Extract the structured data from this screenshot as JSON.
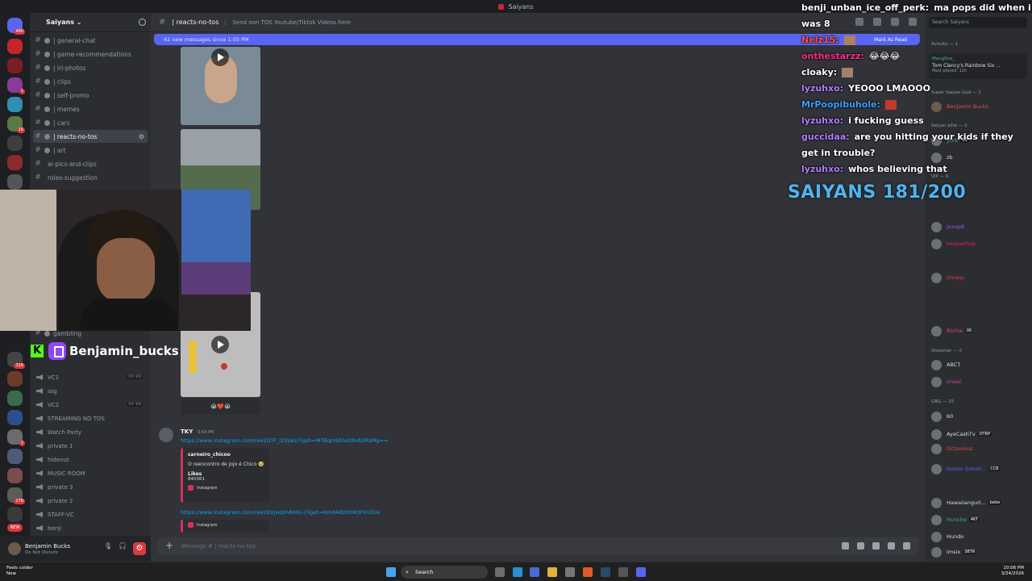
{
  "window": {
    "title": "Saiyans"
  },
  "server": {
    "name": "Saiyans ⌄"
  },
  "channels": [
    {
      "label": "| general-chat"
    },
    {
      "label": "| game-recommendations"
    },
    {
      "label": "| irl-photos"
    },
    {
      "label": "| clips"
    },
    {
      "label": "| self-promo"
    },
    {
      "label": "| memes"
    },
    {
      "label": "| cars"
    },
    {
      "label": "| reacts-no-tos"
    },
    {
      "label": "| art"
    },
    {
      "label": "ai-pics-and-clips"
    },
    {
      "label": "roles-suggestion"
    },
    {
      "label": "gambling"
    }
  ],
  "voice_channels": [
    {
      "label": "VC1",
      "count": "00 99"
    },
    {
      "label": "ssg"
    },
    {
      "label": "VC2",
      "count": "00 99"
    },
    {
      "label": "STREAMING NO TOS"
    },
    {
      "label": "Watch Party"
    },
    {
      "label": "private 1"
    },
    {
      "label": "hideout"
    },
    {
      "label": "MUSIC ROOM"
    },
    {
      "label": "private 3"
    },
    {
      "label": "private 2"
    },
    {
      "label": "STAFF-VC"
    },
    {
      "label": "benji"
    }
  ],
  "rail_badges": [
    "480",
    "1",
    "16",
    "316",
    "2",
    "278",
    "NEW"
  ],
  "user_panel": {
    "name": "Benjamin Bucks",
    "status": "Do Not Disturb"
  },
  "chat": {
    "channel": "| reacts-no-tos",
    "topic": "Send non TOS Youtube/Tiktok Videos here",
    "new_messages": "42 new messages since 1:05 PM",
    "mark_read": "Mark As Read",
    "media_reaction": "😭❤️😭",
    "message": {
      "author": "TKY",
      "time": "9:54 PM",
      "link1": "https://www.instagram.com/reel/DTF_l2Vjski/?igsh=MTBqcHZ0eDRxb2RsMg==",
      "embed": {
        "author": "carneiro_chicoo",
        "description": "O reencontro de jojo é Chico 🥹",
        "likes_label": "Likes",
        "likes": "840361",
        "footer": "Instagram"
      },
      "link2": "https://www.instagram.com/reel/DVJwQmRiHU-/?igsh=bmd4dDhhM3FkY2Ux",
      "footer2": "Instagram"
    },
    "composer_placeholder": "Message # | reacts-no-tos"
  },
  "members": {
    "search_placeholder": "Search Saiyans",
    "activity_header": "Activity — 1",
    "activity": {
      "user": "Mang0ne_",
      "game": "Tom Clancy's Rainbow Six ...",
      "note": "Most played: 11h"
    },
    "sections": [
      {
        "title": "Super Saiyan God — 1",
        "members": [
          {
            "name": "Benjamin Bucks",
            "tag": "",
            "color": "#f04747"
          }
        ]
      },
      {
        "title": "Saiyan elite — 2",
        "members": [
          {
            "name": "yurk",
            "tag": "99",
            "color": "#43b581"
          },
          {
            "name": "zb",
            "tag": "",
            "color": "#dbdee1"
          }
        ]
      },
      {
        "title": "VIP — 9",
        "members": [
          {
            "name": "jxxup9",
            "tag": "",
            "color": "#a259ff"
          },
          {
            "name": "beepachop",
            "tag": "",
            "color": "#e91e63"
          },
          {
            "name": "ohrags",
            "tag": "",
            "color": "#e04040"
          },
          {
            "name": "Richie",
            "tag": "00",
            "color": "#e0409b"
          }
        ]
      },
      {
        "title": "Streamer — 2",
        "members": [
          {
            "name": "ABCT",
            "tag": "",
            "color": "#dbdee1"
          },
          {
            "name": "oneal",
            "tag": "",
            "color": "#e0409b"
          }
        ]
      },
      {
        "title": "GBG — 25",
        "members": [
          {
            "name": "60",
            "tag": "",
            "color": "#dbdee1"
          },
          {
            "name": "AyeCashTv",
            "tag": "DTRP",
            "color": "#dbdee1"
          },
          {
            "name": "Octavious",
            "tag": "",
            "color": "#f04747"
          },
          {
            "name": "Gonzo Gonzo...",
            "tag": "CCB",
            "color": "#5865f2"
          },
          {
            "name": "Hawaiiangurl...",
            "tag": "bebe",
            "color": "#dbdee1"
          },
          {
            "name": "Huncho",
            "tag": "4KT",
            "color": "#43b581"
          },
          {
            "name": "Hundo",
            "tag": "",
            "color": "#dbdee1"
          },
          {
            "name": "imsix",
            "tag": "SBTR",
            "color": "#dbdee1"
          }
        ]
      }
    ]
  },
  "taskbar": {
    "weather": "Feels colder",
    "weather_sub": "Now",
    "search": "Search",
    "time": "10:06 PM",
    "date": "3/24/2026"
  },
  "stream": {
    "streamer": "Benjamin_bucks",
    "chat": [
      {
        "user": "benji_unban_ice_off_perk:",
        "text": "ma pops did when i was 8",
        "color": "#ffffff"
      },
      {
        "user": "Nelz15:",
        "text": "",
        "color": "#ff5050"
      },
      {
        "user": "onthestarzz:",
        "text": "😂😂😂",
        "color": "#ff2a8a"
      },
      {
        "user": "cloaky:",
        "text": "",
        "color": "#ffffff"
      },
      {
        "user": "lyzuhxo:",
        "text": "YEOOO LMAOOO",
        "color": "#b57cff"
      },
      {
        "user": "MrPoopibuhole:",
        "text": "",
        "color": "#3aa0ff"
      },
      {
        "user": "lyzuhxo:",
        "text": "i fucking guess",
        "color": "#b57cff"
      },
      {
        "user": "guccidaa:",
        "text": "are you hitting your kids if they get in trouble?",
        "color": "#b57cff"
      },
      {
        "user": "lyzuhxo:",
        "text": "whos believing that",
        "color": "#b57cff"
      }
    ],
    "goal": "SAIYANS 181/200"
  }
}
